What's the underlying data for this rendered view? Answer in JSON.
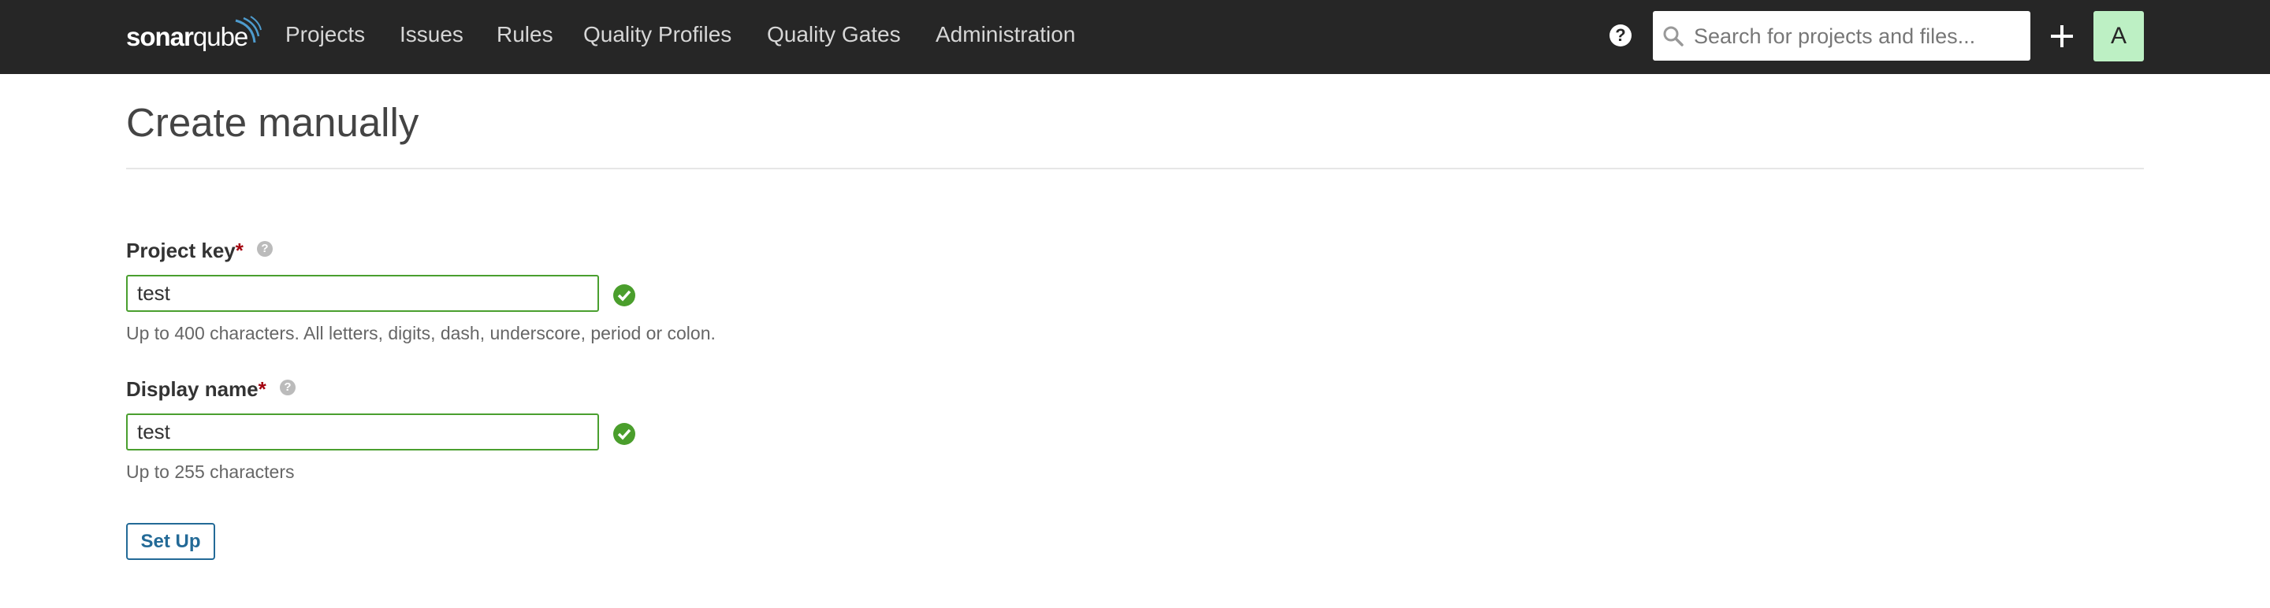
{
  "nav": {
    "logo": {
      "part1": "sonar",
      "part2": "qube"
    },
    "items": [
      "Projects",
      "Issues",
      "Rules",
      "Quality Profiles",
      "Quality Gates",
      "Administration"
    ],
    "help_icon": "?",
    "search_placeholder": "Search for projects and files...",
    "search_value": "",
    "avatar_initial": "A"
  },
  "page": {
    "title": "Create manually",
    "form": {
      "project_key": {
        "label": "Project key",
        "required_mark": "*",
        "value": "test",
        "hint": "Up to 400 characters. All letters, digits, dash, underscore, period or colon."
      },
      "display_name": {
        "label": "Display name",
        "required_mark": "*",
        "value": "test",
        "hint": "Up to 255 characters"
      },
      "submit_label": "Set Up"
    }
  },
  "colors": {
    "nav_bg": "#262626",
    "valid_green": "#4a9f2f",
    "primary_blue": "#236a97",
    "avatar_bg": "#bdf0c4",
    "required_red": "#a4030f"
  }
}
